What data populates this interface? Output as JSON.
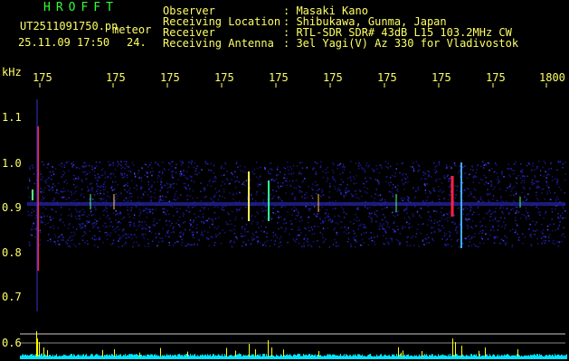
{
  "header": {
    "app_name": "HROFFT",
    "filename": "UT2511091750.pn",
    "mode": "meteor",
    "datetime": "25.11.09 17:50",
    "frame": "24.",
    "observer_label": "Observer",
    "observer_value": ": Masaki Kano",
    "location_label": "Receiving Location",
    "location_value": ": Shibukawa, Gunma, Japan",
    "receiver_label": "Receiver",
    "receiver_value": ": RTL-SDR SDR# 43dB L15 103.2MHz CW",
    "antenna_label": "Receiving Antenna",
    "antenna_value": ": 3el Yagi(V) Az 330 for Vladivostok"
  },
  "axes": {
    "unit": "kHz",
    "x_ticks": [
      "175",
      "175",
      "175",
      "175",
      "175",
      "175",
      "175",
      "175",
      "175",
      "1800"
    ],
    "y_ticks": [
      "1.1",
      "1.0",
      "0.9",
      "0.8",
      "0.7",
      "0.6"
    ]
  },
  "colors": {
    "background": "#000000",
    "text": "#ffff66",
    "title": "#33ff33",
    "noise": "#1a1aa0",
    "signal_hot": "#ff2244",
    "amplitude": "#ffff00",
    "baseline": "#00e5ff"
  }
}
